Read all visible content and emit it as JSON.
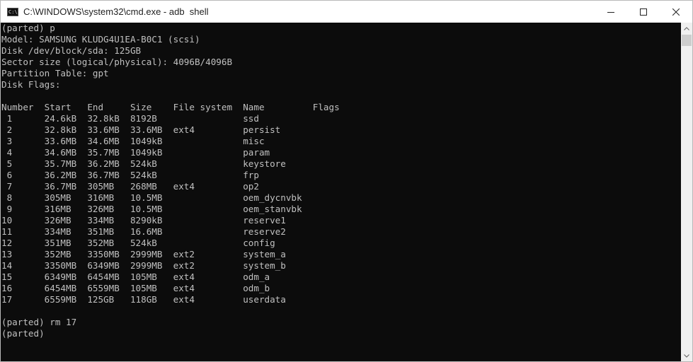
{
  "window": {
    "title": "C:\\WINDOWS\\system32\\cmd.exe - adb  shell",
    "icon_text": "C:\\"
  },
  "console": {
    "text": "(parted) p\nModel: SAMSUNG KLUDG4U1EA-B0C1 (scsi)\nDisk /dev/block/sda: 125GB\nSector size (logical/physical): 4096B/4096B\nPartition Table: gpt\nDisk Flags:\n\nNumber  Start   End     Size    File system  Name         Flags\n 1      24.6kB  32.8kB  8192B                ssd\n 2      32.8kB  33.6MB  33.6MB  ext4         persist\n 3      33.6MB  34.6MB  1049kB               misc\n 4      34.6MB  35.7MB  1049kB               param\n 5      35.7MB  36.2MB  524kB                keystore\n 6      36.2MB  36.7MB  524kB                frp\n 7      36.7MB  305MB   268MB   ext4         op2\n 8      305MB   316MB   10.5MB               oem_dycnvbk\n 9      316MB   326MB   10.5MB               oem_stanvbk\n10      326MB   334MB   8290kB               reserve1\n11      334MB   351MB   16.6MB               reserve2\n12      351MB   352MB   524kB                config\n13      352MB   3350MB  2999MB  ext2         system_a\n14      3350MB  6349MB  2999MB  ext2         system_b\n15      6349MB  6454MB  105MB   ext4         odm_a\n16      6454MB  6559MB  105MB   ext4         odm_b\n17      6559MB  125GB   118GB   ext4         userdata\n\n(parted) rm 17\n(parted)"
  },
  "colors": {
    "console_bg": "#0c0c0c",
    "console_fg": "#c0c0c0",
    "titlebar_bg": "#ffffff"
  },
  "icons": {
    "minimize": "minimize-icon",
    "maximize": "maximize-icon",
    "close": "close-icon",
    "scroll_up": "chevron-up-icon",
    "scroll_down": "chevron-down-icon"
  }
}
